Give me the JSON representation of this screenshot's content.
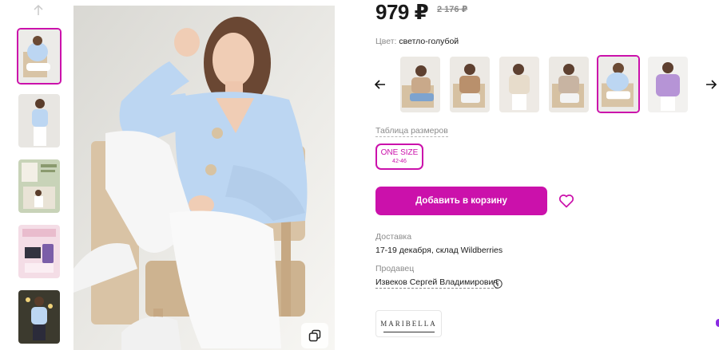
{
  "product": {
    "price": "979 ₽",
    "old_price": "2 176 ₽",
    "color_label": "Цвет:",
    "color_value": "светло-голубой"
  },
  "color_variants": [
    {
      "name": "beige",
      "tone": "#c9a98a"
    },
    {
      "name": "camel",
      "tone": "#b9906c"
    },
    {
      "name": "cream",
      "tone": "#e7dccb"
    },
    {
      "name": "taupe",
      "tone": "#c8b4a2"
    },
    {
      "name": "light-blue",
      "tone": "#bcd6f2"
    },
    {
      "name": "lilac",
      "tone": "#b694d6"
    }
  ],
  "sizes": {
    "table_link": "Таблица размеров",
    "options": [
      {
        "label": "ONE SIZE",
        "range": "42-46"
      }
    ]
  },
  "actions": {
    "add_to_cart": "Добавить в корзину"
  },
  "delivery": {
    "label": "Доставка",
    "value": "17-19 декабря, склад Wildberries"
  },
  "seller": {
    "label": "Продавец",
    "name": "Извеков Сергей Владимирович"
  },
  "brand": {
    "name": "MARIBELLA"
  },
  "colors": {
    "accent": "#cb11ab"
  }
}
